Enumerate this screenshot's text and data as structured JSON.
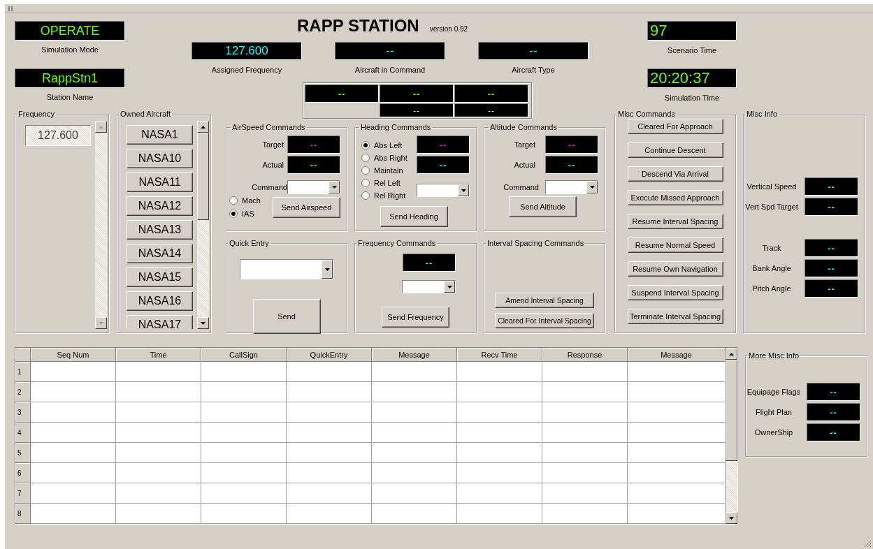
{
  "title": "RAPP STATION",
  "version": "version 0.92",
  "status": [
    {
      "label": "Simulation Mode",
      "value": "OPERATE"
    },
    {
      "label": "Station Name",
      "value": "RappStn1"
    }
  ],
  "aircraft_info": [
    {
      "label": "Assigned Frequency",
      "value": "127.600"
    },
    {
      "label": "Aircraft in Command",
      "value": "--"
    },
    {
      "label": "Aircraft Type",
      "value": "--"
    }
  ],
  "readout_grid": {
    "top": [
      "--",
      "--",
      "--"
    ],
    "bottom": [
      "--",
      "--"
    ]
  },
  "times": [
    {
      "label": "Scenario Time",
      "value": "97"
    },
    {
      "label": "Simulation Time",
      "value": "20:20:37"
    }
  ],
  "frequency": {
    "title": "Frequency",
    "items": [
      "127.600"
    ]
  },
  "owned_aircraft": {
    "title": "Owned Aircraft",
    "items": [
      "NASA1",
      "NASA10",
      "NASA11",
      "NASA12",
      "NASA13",
      "NASA14",
      "NASA15",
      "NASA16",
      "NASA17"
    ]
  },
  "airspeed_commands": {
    "title": "AirSpeed Commands",
    "readouts": [
      {
        "label": "Target",
        "value": "--",
        "kind": "target"
      },
      {
        "label": "Actual",
        "value": "--",
        "kind": "actual"
      }
    ],
    "command_label": "Command",
    "modes": [
      {
        "label": "Mach",
        "selected": false
      },
      {
        "label": "IAS",
        "selected": true
      }
    ],
    "button": "Send Airspeed"
  },
  "heading_commands": {
    "title": "Heading Commands",
    "modes": [
      {
        "label": "Abs Left",
        "selected": true
      },
      {
        "label": "Abs Right",
        "selected": false
      },
      {
        "label": "Maintain",
        "selected": false
      },
      {
        "label": "Rel Left",
        "selected": false
      },
      {
        "label": "Rel Right",
        "selected": false
      }
    ],
    "readouts": [
      {
        "value": "--",
        "kind": "target"
      },
      {
        "value": "--",
        "kind": "actual"
      }
    ],
    "button": "Send Heading"
  },
  "altitude_commands": {
    "title": "Altitude Commands",
    "readouts": [
      {
        "label": "Target",
        "value": "--",
        "kind": "target"
      },
      {
        "label": "Actual",
        "value": "--",
        "kind": "actual"
      }
    ],
    "command_label": "Command",
    "button": "Send Altitude"
  },
  "quick_entry": {
    "title": "Quick Entry",
    "button": "Send"
  },
  "frequency_commands": {
    "title": "Frequency Commands",
    "readout": "--",
    "button": "Send Frequency"
  },
  "interval_spacing_commands": {
    "title": "Interval Spacing Commands",
    "buttons": [
      "Amend Interval Spacing",
      "Cleared For Interval Spacing"
    ]
  },
  "misc_commands": {
    "title": "Misc Commands",
    "buttons": [
      "Cleared For Approach",
      "Continue Descent",
      "Descend Via Arrival",
      "Execute Missed Approach",
      "Resume Interval Spacing",
      "Resume Normal Speed",
      "Resume Own Navigation",
      "Suspend Interval Spacing",
      "Terminate Interval Spacing"
    ]
  },
  "misc_info": {
    "title": "Misc Info",
    "groups": [
      [
        {
          "label": "Vertical Speed",
          "value": "--"
        },
        {
          "label": "Vert Spd Target",
          "value": "--"
        }
      ],
      [
        {
          "label": "Track",
          "value": "--"
        },
        {
          "label": "Bank Angle",
          "value": "--"
        },
        {
          "label": "Pitch Angle",
          "value": "--"
        }
      ]
    ]
  },
  "message_table": {
    "columns": [
      "Seq Num",
      "Time",
      "CallSign",
      "QuickEntry",
      "Message",
      "Recv Time",
      "Response",
      "Message"
    ],
    "rows": [
      "1",
      "2",
      "3",
      "4",
      "5",
      "6",
      "7",
      "8"
    ]
  },
  "more_misc_info": {
    "title": "More Misc Info",
    "rows": [
      {
        "label": "Equipage Flags",
        "value": "--"
      },
      {
        "label": "Flight Plan",
        "value": "--"
      },
      {
        "label": "OwnerShip",
        "value": "--"
      }
    ]
  }
}
